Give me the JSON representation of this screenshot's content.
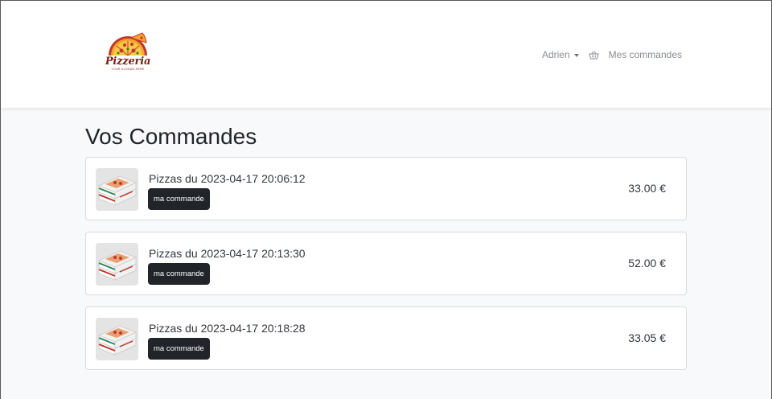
{
  "brand": {
    "name": "Pizzeria",
    "tagline": "YOUR SLOGAN HERE"
  },
  "nav": {
    "user_label": "Adrien",
    "orders_label": "Mes commandes",
    "cart_icon": "basket-icon"
  },
  "page": {
    "title": "Vos Commandes"
  },
  "orders": [
    {
      "title": "Pizzas du 2023-04-17 20:06:12",
      "button": "ma commande",
      "price": "33.00 €"
    },
    {
      "title": "Pizzas du 2023-04-17 20:13:30",
      "button": "ma commande",
      "price": "52.00 €"
    },
    {
      "title": "Pizzas du 2023-04-17 20:18:28",
      "button": "ma commande",
      "price": "33.05 €"
    }
  ],
  "colors": {
    "button_bg": "#212529",
    "page_bg": "#f8f9fa",
    "brand": "#7b1f16"
  }
}
